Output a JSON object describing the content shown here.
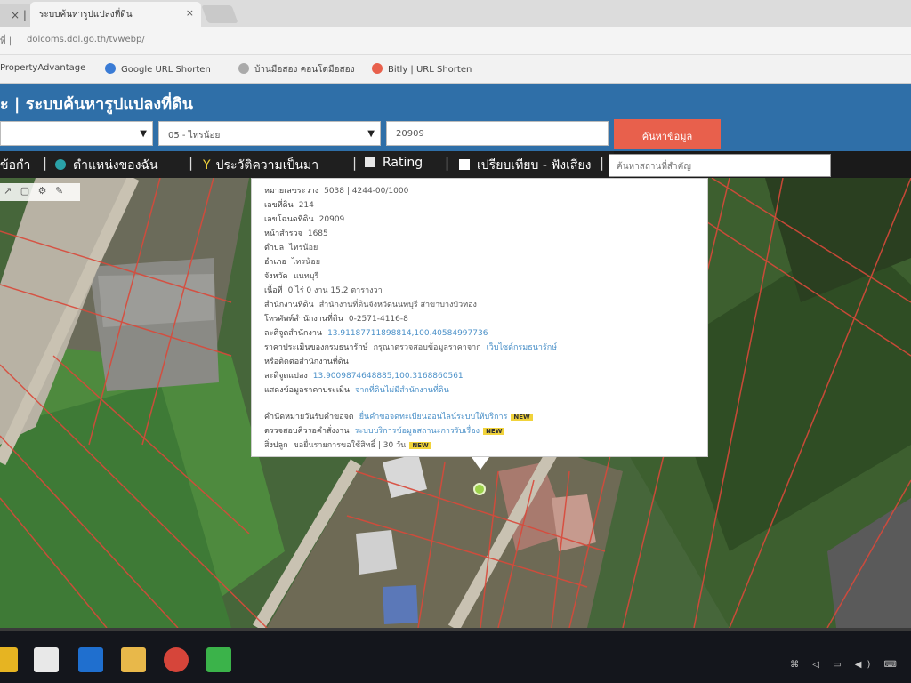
{
  "browser": {
    "prev_tab_label": "× |",
    "active_tab_title": "ระบบค้นหารูปแปลงที่ดิน",
    "tab_close": "×",
    "address_prefix": "ที่ |",
    "url": "dolcoms.dol.go.th/tvwebp/"
  },
  "bookmarks": [
    {
      "label": "PropertyAdvantage",
      "icon_color": "#f3f3f3"
    },
    {
      "label": "Google URL Shorten",
      "icon_color": "#3a7bd5"
    },
    {
      "label": "บ้านมือสอง คอนโดมือสอง",
      "icon_color": "#aaaaaa"
    },
    {
      "label": "Bitly | URL Shorten",
      "icon_color": "#e8604c"
    }
  ],
  "site": {
    "title": "ะ | ระบบค้นหารูปแปลงที่ดิน"
  },
  "search": {
    "province_select": "",
    "amphoe_select": "05 - ไทรน้อย",
    "parcel_input": "20909",
    "search_button": "ค้นหาข้อมูล"
  },
  "toolbar": {
    "item1": "ข้อกำ",
    "item2": "ตำแหน่งของฉัน",
    "item3": "ประวัติความเป็นมา",
    "item4": "Rating",
    "item5": "เปรียบเทียบ - ฟังเสียง",
    "separator": "|",
    "right_search_placeholder": "ค้นหาสถานที่สำคัญ"
  },
  "map_tools": [
    "↗",
    "▢",
    "⚙",
    "✎"
  ],
  "popup": {
    "rows": [
      {
        "label": "หมายเลขระวาง",
        "value": "5038 | 4244-00/1000"
      },
      {
        "label": "เลขที่ดิน",
        "value": "214"
      },
      {
        "label": "เลขโฉนดที่ดิน",
        "value": "20909"
      },
      {
        "label": "หน้าสำรวจ",
        "value": "1685"
      },
      {
        "label": "ตำบล",
        "value": "ไทรน้อย"
      },
      {
        "label": "อำเภอ",
        "value": "ไทรน้อย"
      },
      {
        "label": "จังหวัด",
        "value": "นนทบุรี"
      },
      {
        "label": "เนื้อที่",
        "value": "0 ไร่ 0 งาน 15.2 ตารางวา"
      },
      {
        "label": "สำนักงานที่ดิน",
        "value": "สำนักงานที่ดินจังหวัดนนทบุรี สาขาบางบัวทอง"
      },
      {
        "label": "โทรศัพท์สำนักงานที่ดิน",
        "value": "0-2571-4116-8"
      },
      {
        "label": "ละติจูดสำนักงาน",
        "link": "13.91187711898814,100.40584997736"
      },
      {
        "label": "ราคาประเมินของกรมธนารักษ์",
        "value": "กรุณาตรวจสอบข้อมูลราคาจาก",
        "link": "เว็บไซต์กรมธนารักษ์"
      },
      {
        "label": "หรือติดต่อสำนักงานที่ดิน",
        "value": ""
      },
      {
        "label": "ละติจูดแปลง",
        "link": "13.9009874648885,100.3168860561"
      },
      {
        "label": "แสดงข้อมูลราคาประเมิน",
        "link": "จากที่ดินไม่มีสำนักงานที่ดิน"
      }
    ],
    "notes": [
      {
        "label": "คำนัดหมายวันรับคำขอจด",
        "link": "ยื่นคำขอจดทะเบียนออนไลน์ระบบให้บริการ",
        "badge": "NEW"
      },
      {
        "label": "ตรวจสอบคิวรอคำสั่งงาน",
        "link": "ระบบบริการข้อมูลสถานะการรับเรื่อง",
        "badge": "NEW"
      },
      {
        "label": "สิ่งปลูก",
        "value": "ขอยื่นรายการขอใช้สิทธิ์ | 30 วัน",
        "badge": "NEW"
      }
    ]
  },
  "colors": {
    "header_blue": "#2f6fa8",
    "search_button": "#e8604c",
    "toolbar_bg": "#1f1f1f",
    "link": "#4a90c8",
    "badge": "#f1d33b"
  },
  "taskbar": {
    "buttons": [
      "store-icon",
      "mail-icon",
      "edge-icon",
      "explorer-icon",
      "chrome-icon",
      "app-icon"
    ],
    "tray": "⌘ ◁ ▭ ◀) ⌨"
  }
}
